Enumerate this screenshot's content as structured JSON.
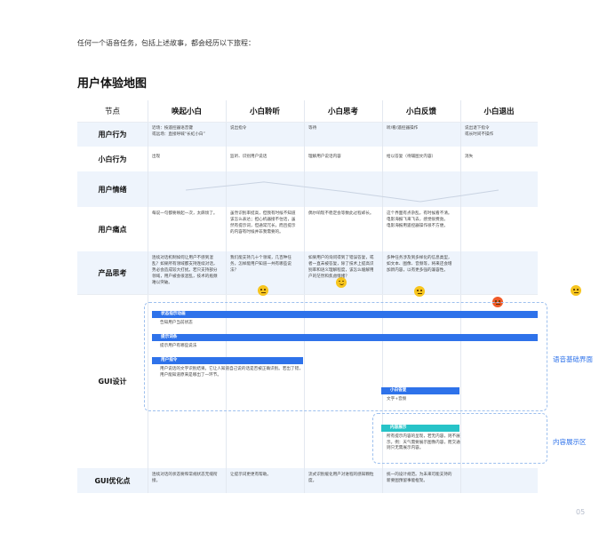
{
  "intro": "任何一个语音任务，包括上述故事，都会经历以下旅程：",
  "title": "用户体验地图",
  "header": {
    "corner": "节点",
    "stages": [
      "唤起小白",
      "小白聆听",
      "小白思考",
      "小白反馈",
      "小白退出"
    ]
  },
  "rows": {
    "behavior": {
      "label": "用户行为",
      "cells": [
        "近场：按遥控器语音键\n或远场：直接呼喊“长虹小白”",
        "说出指令",
        "等待",
        "听/看/遥控器操作",
        "说出退下指令\n或长时间不操作"
      ]
    },
    "assistant": {
      "label": "小白行为",
      "cells": [
        "出现",
        "监听、识别用户说话",
        "理解用户说话内容",
        "给以答复（待辅图文内容）",
        "消失"
      ]
    },
    "emotion": {
      "label": "用户情绪",
      "levels": [
        0.5,
        0.85,
        0.45,
        0.0,
        0.5
      ],
      "mood_colors": [
        "#f7c51e",
        "#f7c51e",
        "#f7c51e",
        "#f05a28",
        "#f7c51e"
      ]
    },
    "pain": {
      "label": "用户痛点",
      "cells": [
        "每说一句都要唤起一次，太麻烦了。",
        "虽然识别率挺高，但我有时候不知道该怎么表达；担心机器接不住话，虽然有提示词，但通常冗长，而且提示的内容有时候并非我需要的。",
        "偶尔响现不稳定会等数此过程却长。",
        "这个界面有点杂乱，有时候看不清。\n电影海报飞来飞去，感觉很费劲。\n电影海报用遥控器操作很不方便。"
      ]
    },
    "product": {
      "label": "产品思考",
      "cells": [
        "连续对话机制如何让用户不感到混乱？如果所有领域都支持连续对话，势必会造成较大打扰。若只支持部分领域，用户被会很混乱，技术的瓶颈难以突破。",
        "我们能支持几十个领域，几百种任务，怎样能用户知道一共有哪些说法？",
        "如果用户的询问得到了错误答复，或者一直未被答复，除了技术上提高识别率和语义理解程度，该怎么缓解用户的茫然和焦虑情绪？",
        "多种任务涉及到多样化的信息类型，如文本、图像、音频等，将来还会增加新内容，以有更多强的兼容性。"
      ]
    },
    "gui": {
      "label": "GUI设计"
    },
    "gui_opt": {
      "label": "GUI优化点",
      "cells": [
        "连续对话的状态要和常规状态无缝衔接。",
        "让提示词更更有帮助。",
        "流式识别缓化用户对进程的感知颗粒度。",
        "统一的设计规范。为未来可能支持的新要图预留事能框架。"
      ]
    }
  },
  "gui_bars": {
    "status": {
      "title": "状态指示动画",
      "desc": "告知用户当前状态"
    },
    "hints": {
      "title": "提示词条",
      "desc": "提示用户有哪些说法"
    },
    "command": {
      "title": "用户指令",
      "desc": "用户说话的文字识别结果。它让人知道自己说的话是否被正确识别。若出了错，用户能知道原来是哪出了一环节。"
    },
    "reply": {
      "title": "小白答复",
      "desc": "文字+音频"
    },
    "content": {
      "title": "内容展示",
      "desc": "所有提示内容的呈现，若无内容，则不展示。例：天气需要展示图像内容，而交通则只无需展示内容。"
    }
  },
  "side_labels": {
    "voice": "语音基础界面",
    "content": "内容展示区"
  },
  "page_number": "05"
}
